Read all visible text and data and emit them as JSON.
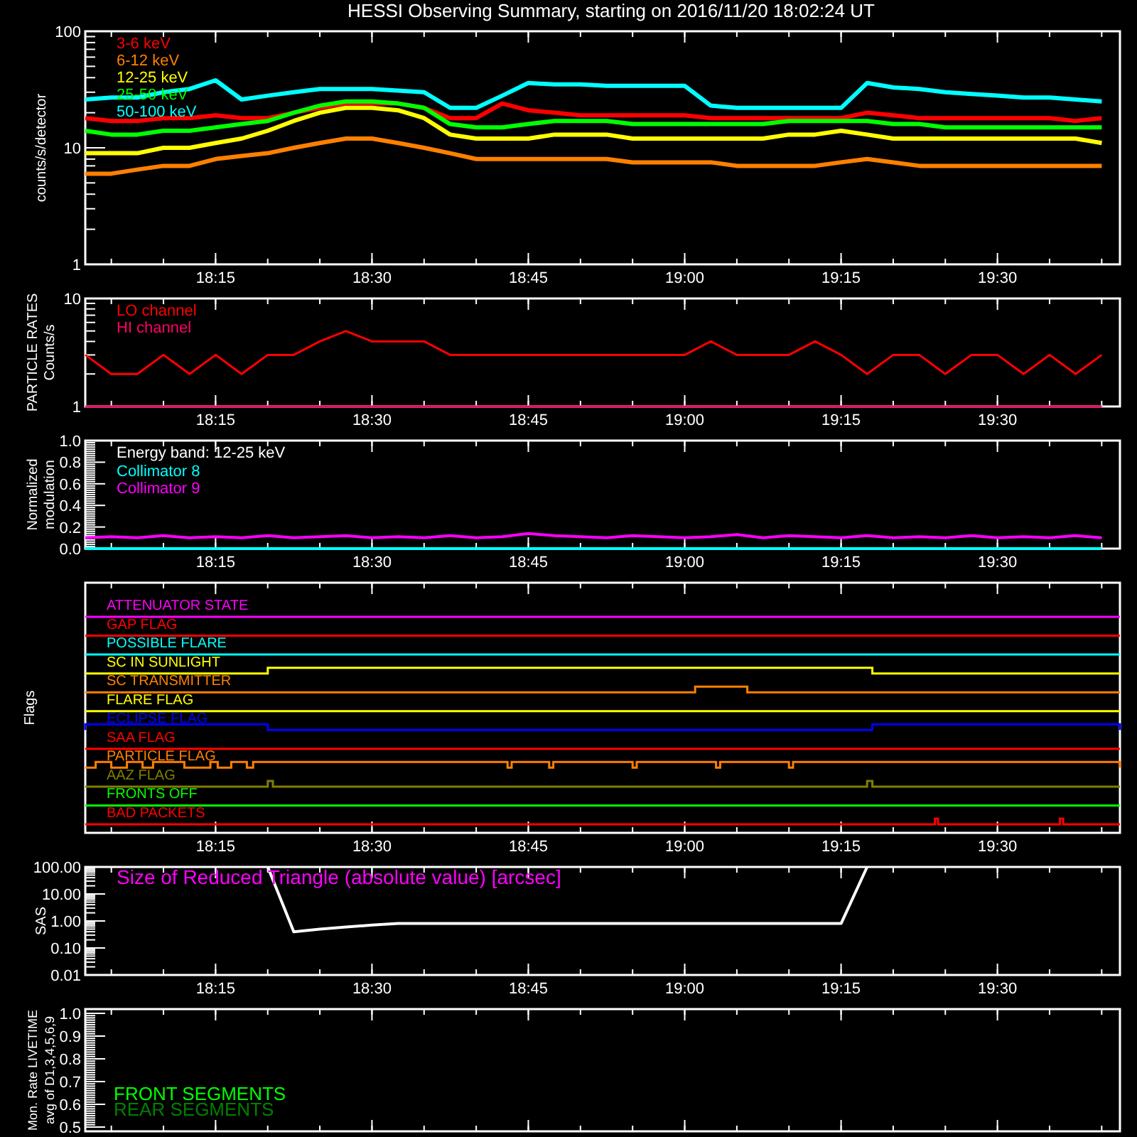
{
  "title": "HESSI Observing Summary, starting on 2016/11/20 18:02:24 UT",
  "panels": [
    {
      "kind": "log_plot",
      "ylabel": [
        "counts/s/detector"
      ],
      "y_tick_labels": [
        "100",
        "10",
        "1"
      ],
      "x_tick_labels": [
        "18:15",
        "18:30",
        "18:45",
        "19:00",
        "19:15",
        "19:30"
      ],
      "legend": [
        {
          "label": "3-6 keV",
          "color": "#ff0000"
        },
        {
          "label": "6-12 keV",
          "color": "#ff8000"
        },
        {
          "label": "12-25 keV",
          "color": "#ffff00"
        },
        {
          "label": "25-50 keV",
          "color": "#00ff00"
        },
        {
          "label": "50-100 keV",
          "color": "#00ffff"
        }
      ]
    },
    {
      "kind": "log_plot",
      "ylabel": [
        "PARTICLE RATES",
        "Counts/s"
      ],
      "y_tick_labels": [
        "10",
        "1"
      ],
      "x_tick_labels": [
        "18:15",
        "18:30",
        "18:45",
        "19:00",
        "19:15",
        "19:30"
      ],
      "legend": [
        {
          "label": "LO channel",
          "color": "#ff0000"
        },
        {
          "label": "HI channel",
          "color": "#ff0066"
        }
      ]
    },
    {
      "kind": "chart",
      "chart_data": {
        "type": "line",
        "ylabel": "Normalized\nmodulation",
        "ylim": [
          0,
          1
        ],
        "yticks": [
          {
            "value": 0,
            "label": "0.0"
          },
          {
            "value": 0.2,
            "label": "0.2"
          },
          {
            "value": 0.4,
            "label": "0.4"
          },
          {
            "value": 0.6,
            "label": "0.6"
          },
          {
            "value": 0.8,
            "label": "0.8"
          },
          {
            "value": 1,
            "label": "1.0"
          }
        ],
        "annotations": [
          "Energy band: 12-25 keV"
        ],
        "categories": [
          null,
          null,
          null,
          null,
          null,
          "18:15",
          null,
          null,
          null,
          null,
          null,
          "18:30",
          null,
          null,
          null,
          null,
          null,
          "18:45",
          null,
          null,
          null,
          null,
          null,
          "19:00",
          null,
          null,
          null,
          null,
          null,
          "19:15",
          null,
          null,
          null,
          null,
          null,
          "19:30",
          null,
          null,
          null,
          null
        ],
        "series": [
          {
            "name": "Collimator 8",
            "color": "#00ffff",
            "values": [
              0,
              0,
              0,
              0,
              0,
              0,
              0,
              0,
              0,
              0,
              0,
              0,
              0,
              0,
              0,
              0,
              0,
              0,
              0,
              0,
              0,
              0,
              0,
              0,
              0,
              0,
              0,
              0,
              0,
              0,
              0,
              0,
              0,
              0,
              0,
              0,
              0,
              0,
              0,
              0
            ]
          },
          {
            "name": "Collimator 9",
            "color": "#ff00ff",
            "values": [
              0.1,
              0.11,
              0.1,
              0.12,
              0.1,
              0.11,
              0.1,
              0.12,
              0.1,
              0.11,
              0.12,
              0.1,
              0.11,
              0.1,
              0.12,
              0.1,
              0.11,
              0.14,
              0.12,
              0.11,
              0.1,
              0.12,
              0.11,
              0.1,
              0.11,
              0.13,
              0.1,
              0.12,
              0.11,
              0.1,
              0.12,
              0.1,
              0.11,
              0.1,
              0.12,
              0.1,
              0.11,
              0.1,
              0.12,
              0.1
            ]
          }
        ]
      }
    },
    {
      "kind": "flags",
      "ylabel": "Flags",
      "tick_labels": [
        "18:15",
        "18:30",
        "18:45",
        "19:00",
        "19:15",
        "19:30"
      ],
      "flags": [
        {
          "label": "ATTENUATOR STATE",
          "color": "#ff00ff"
        },
        {
          "label": "GAP FLAG",
          "color": "#ff0000"
        },
        {
          "label": "POSSIBLE FLARE",
          "color": "#00ffff"
        },
        {
          "label": "SC IN SUNLIGHT",
          "color": "#ffff00"
        },
        {
          "label": "SC TRANSMITTER",
          "color": "#ff8000"
        },
        {
          "label": "FLARE FLAG",
          "color": "#ffff00"
        },
        {
          "label": "ECLIPSE FLAG",
          "color": "#0000ff"
        },
        {
          "label": "SAA FLAG",
          "color": "#ff0000"
        },
        {
          "label": "PARTICLE FLAG",
          "color": "#ff8000"
        },
        {
          "label": "AAZ FLAG",
          "color": "#808000"
        },
        {
          "label": "FRONTS OFF",
          "color": "#00ff00"
        },
        {
          "label": "BAD PACKETS",
          "color": "#ff0000"
        }
      ]
    },
    {
      "kind": "log_plot",
      "ylabel": [
        "SAS"
      ],
      "y_tick_labels": [
        "100.00",
        "10.00",
        "1.00",
        "0.10",
        "0.01"
      ],
      "x_tick_labels": [
        "18:15",
        "18:30",
        "18:45",
        "19:00",
        "19:15",
        "19:30"
      ],
      "annotations": [
        "Size of Reduced Triangle (absolute value) [arcsec]"
      ]
    },
    {
      "kind": "blank",
      "ylabel": [
        "Mon. Rate LIVETIME",
        "avg of D1,3,4,5,6,9"
      ],
      "yticks": [
        "1.0",
        "0.9",
        "0.8",
        "0.7",
        "0.6",
        "0.5"
      ],
      "legend": [
        {
          "label": "FRONT SEGMENTS",
          "color": "#00ff00"
        },
        {
          "label": "REAR SEGMENTS",
          "color": "#008000"
        }
      ]
    }
  ]
}
